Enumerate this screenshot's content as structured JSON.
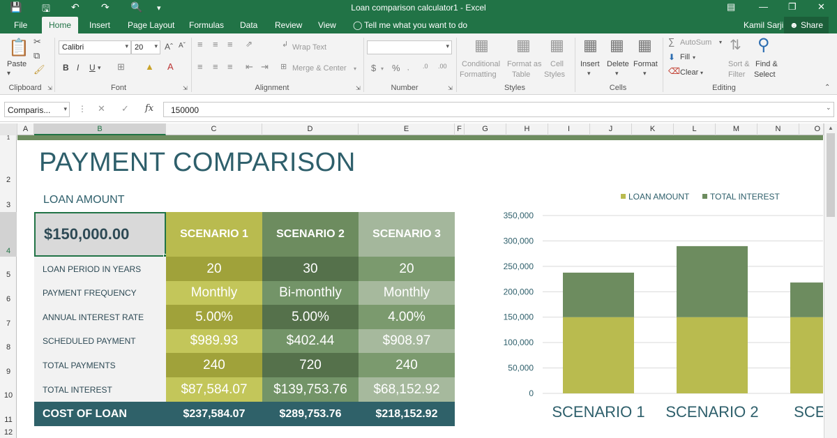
{
  "window": {
    "title": "Loan comparison calculator1 - Excel"
  },
  "tabs": [
    "File",
    "Home",
    "Insert",
    "Page Layout",
    "Formulas",
    "Data",
    "Review",
    "View"
  ],
  "tell_me": "Tell me what you want to do",
  "user": "Kamil Sarji",
  "share": "Share",
  "ribbon": {
    "paste": "Paste",
    "clipboard": "Clipboard",
    "font_name": "Calibri",
    "font_size": "20",
    "font": "Font",
    "wrap_text": "Wrap Text",
    "merge_center": "Merge & Center",
    "alignment": "Alignment",
    "number": "Number",
    "conditional_formatting": "Conditional\nFormatting",
    "conditional_1": "Conditional",
    "conditional_2": "Formatting",
    "format_as_1": "Format as",
    "format_as_2": "Table",
    "cell_styles_1": "Cell",
    "cell_styles_2": "Styles",
    "styles": "Styles",
    "insert": "Insert",
    "delete": "Delete",
    "format": "Format",
    "cells": "Cells",
    "autosum": "AutoSum",
    "fill": "Fill",
    "clear": "Clear",
    "sort_1": "Sort &",
    "sort_2": "Filter",
    "find_1": "Find &",
    "find_2": "Select",
    "editing": "Editing",
    "bold": "B",
    "italic": "I",
    "underline": "U",
    "dollar": "$",
    "percent": "%"
  },
  "formula_bar": {
    "name_box": "Comparis...",
    "fx": "fx",
    "value": "150000"
  },
  "columns": [
    "A",
    "B",
    "C",
    "D",
    "E",
    "F",
    "G",
    "H",
    "I",
    "J",
    "K",
    "L",
    "M",
    "N",
    "O"
  ],
  "rows": [
    "1",
    "2",
    "3",
    "4",
    "5",
    "6",
    "7",
    "8",
    "9",
    "10",
    "11",
    "12"
  ],
  "sheet": {
    "title": "PAYMENT COMPARISON",
    "loan_amount_label": "LOAN AMOUNT",
    "loan_amount": "$150,000.00",
    "scenarios": [
      "SCENARIO 1",
      "SCENARIO 2",
      "SCENARIO 3"
    ],
    "row_labels": [
      "LOAN PERIOD IN YEARS",
      "PAYMENT FREQUENCY",
      "ANNUAL INTEREST RATE",
      "SCHEDULED PAYMENT",
      "TOTAL PAYMENTS",
      "TOTAL INTEREST"
    ],
    "values": [
      [
        "20",
        "30",
        "20"
      ],
      [
        "Monthly",
        "Bi-monthly",
        "Monthly"
      ],
      [
        "5.00%",
        "5.00%",
        "4.00%"
      ],
      [
        "$989.93",
        "$402.44",
        "$908.97"
      ],
      [
        "240",
        "720",
        "240"
      ],
      [
        "$87,584.07",
        "$139,753.76",
        "$68,152.92"
      ]
    ],
    "cost_label": "COST OF LOAN",
    "cost_values": [
      "$237,584.07",
      "$289,753.76",
      "$218,152.92"
    ]
  },
  "colors": {
    "excel_green": "#217346",
    "title_teal": "#2e5f6b",
    "s1_head": "#b9bb4f",
    "s2_head": "#6d8c5f",
    "s3_head": "#a4b79c",
    "cost_bar": "#2f6169"
  },
  "chart_data": {
    "type": "bar",
    "stacked": true,
    "categories": [
      "SCENARIO 1",
      "SCENARIO 2",
      "SCENARIO 3"
    ],
    "series": [
      {
        "name": "LOAN AMOUNT",
        "values": [
          150000,
          150000,
          150000
        ],
        "color": "#b9bb4f"
      },
      {
        "name": "TOTAL INTEREST",
        "values": [
          87584.07,
          139753.76,
          68152.92
        ],
        "color": "#6d8c5f"
      }
    ],
    "ylim": [
      0,
      350000
    ],
    "yticks": [
      0,
      50000,
      100000,
      150000,
      200000,
      250000,
      300000,
      350000
    ],
    "ytick_labels": [
      "0",
      "50,000",
      "100,000",
      "150,000",
      "200,000",
      "250,000",
      "300,000",
      "350,000"
    ],
    "legend_position": "top",
    "grid": true,
    "xtick_labels_visible": [
      "SCENARIO 1",
      "SCENARIO 2",
      "SCENAR"
    ]
  }
}
